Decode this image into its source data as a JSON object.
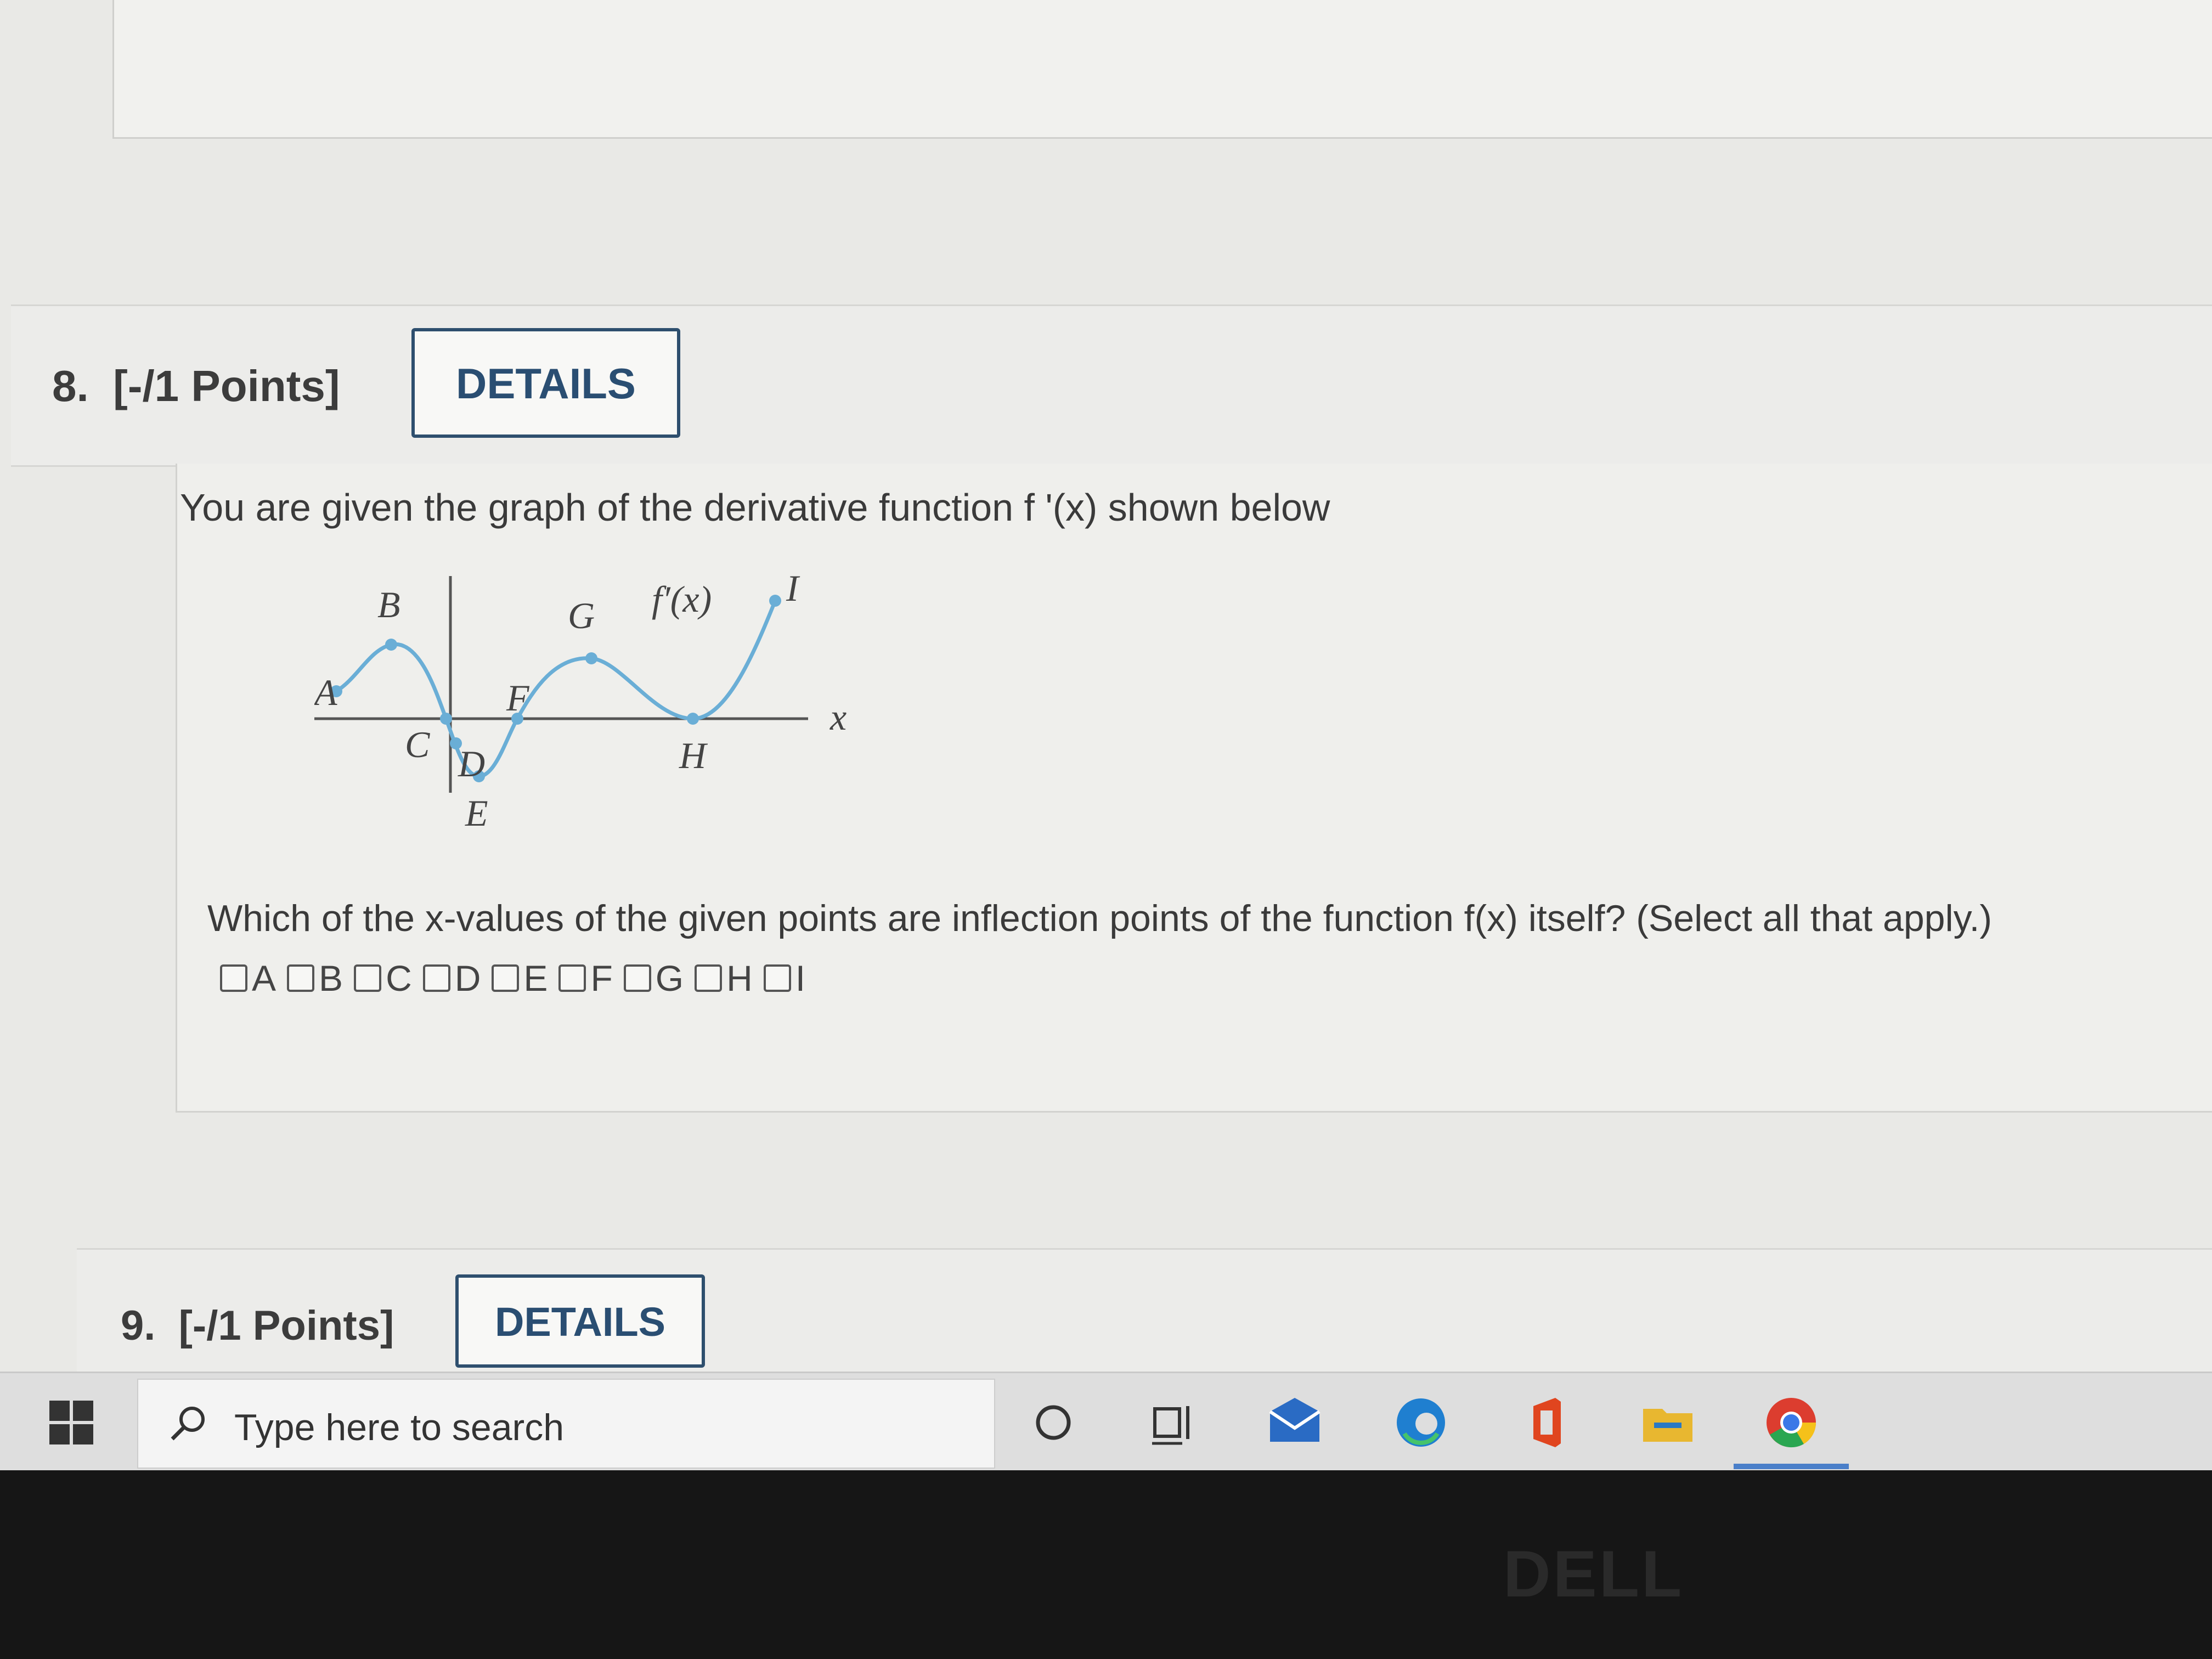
{
  "question8": {
    "number": "8.",
    "points": "[-/1 Points]",
    "details_label": "DETAILS",
    "prompt": "You are given the graph of the derivative function f '(x) shown below",
    "question": "Which of the x-values of the given points are inflection points of the function f(x) itself? (Select all that apply.)",
    "choices": [
      "A",
      "B",
      "C",
      "D",
      "E",
      "F",
      "G",
      "H",
      "I"
    ]
  },
  "graph": {
    "function_label": "f′(x)",
    "x_axis_label": "x",
    "curve_color": "#6aaed6",
    "point_labels": {
      "A": "A",
      "B": "B",
      "C": "C",
      "D": "D",
      "E": "E",
      "F": "F",
      "G": "G",
      "H": "H",
      "I": "I"
    }
  },
  "question9": {
    "number": "9.",
    "points": "[-/1 Points]",
    "details_label": "DETAILS"
  },
  "taskbar": {
    "search_placeholder": "Type here to search",
    "icons": [
      "windows-icon",
      "search-icon",
      "cortana-icon",
      "task-view-icon",
      "mail-icon",
      "edge-icon",
      "office-icon",
      "file-explorer-icon",
      "chrome-icon"
    ]
  },
  "bezel": {
    "brand": "DELL"
  }
}
